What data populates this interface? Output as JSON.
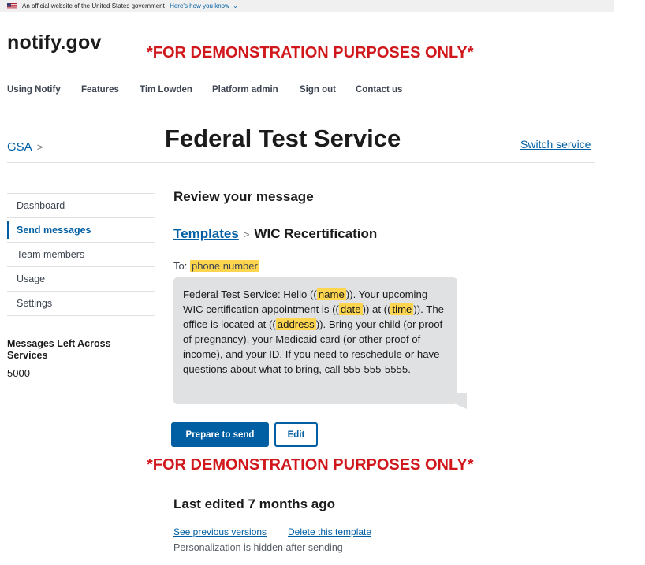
{
  "gov_banner": {
    "text": "An official website of the United States government",
    "link": "Here's how you know",
    "chevron": "⌄"
  },
  "logo": "notify.gov",
  "demo_notice": "*FOR DEMONSTRATION PURPOSES ONLY*",
  "nav": {
    "items": [
      "Using Notify",
      "Features",
      "Tim Lowden",
      "Platform admin",
      "Sign out",
      "Contact us"
    ]
  },
  "breadcrumb": {
    "org": "GSA",
    "separator": ">"
  },
  "service_name": "Federal Test Service",
  "switch_service": "Switch service",
  "sidenav": {
    "items": [
      "Dashboard",
      "Send messages",
      "Team members",
      "Usage",
      "Settings"
    ],
    "active": "Send messages"
  },
  "messages_left": {
    "label": "Messages Left Across Services",
    "value": "5000"
  },
  "review": {
    "title": "Review your message",
    "templates_link": "Templates",
    "crumb_separator": ">",
    "template_name": "WIC Recertification",
    "to_label": "To:",
    "to_value": "phone number"
  },
  "message": {
    "p1": "Federal Test Service: Hello ((",
    "name": "name",
    "p2": ")). Your upcoming WIC certification appointment is ((",
    "date": "date",
    "p3": ")) at ((",
    "time": "time",
    "p4": ")). The office is located at ((",
    "address": "address",
    "p5": ")). Bring your child (or proof of pregnancy), your Medicaid card (or other proof of income), and your ID. If you need to reschedule or have questions about what to bring, call 555-555-5555."
  },
  "buttons": {
    "prepare": "Prepare to send",
    "edit": "Edit"
  },
  "last_edited": "Last edited 7 months ago",
  "links": {
    "previous_versions": "See previous versions",
    "delete_template": "Delete this template"
  },
  "personalization_note": "Personalization is hidden after sending",
  "colors": {
    "brand_blue": "#005ea2",
    "demo_red": "#d0171c",
    "highlight": "#fdd54e",
    "bubble": "#dfe1e2"
  }
}
